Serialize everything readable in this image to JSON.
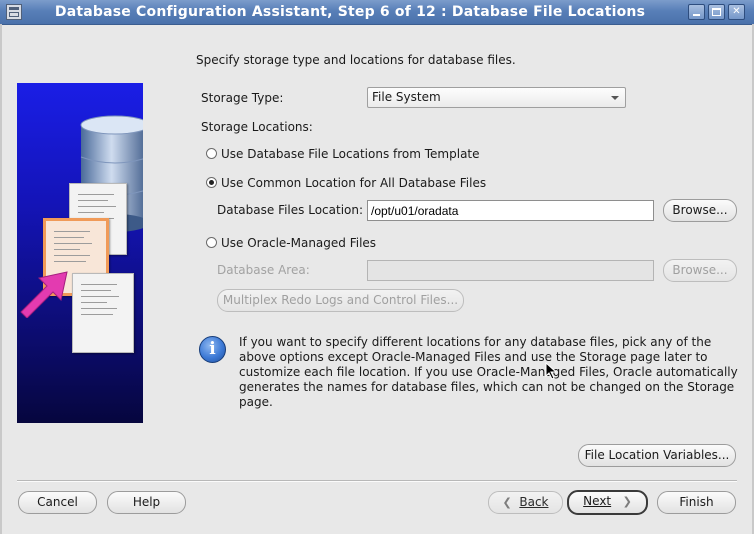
{
  "window": {
    "title": "Database Configuration Assistant, Step 6 of 12 : Database File Locations",
    "controls": [
      "minimize-icon",
      "maximize-icon",
      "close-icon"
    ]
  },
  "instruction": "Specify storage type and locations for database files.",
  "storage_type": {
    "label": "Storage Type:",
    "selected": "File System"
  },
  "storage_locations": {
    "label": "Storage Locations:",
    "options": [
      {
        "label": "Use Database File Locations from Template",
        "selected": false,
        "enabled": true
      },
      {
        "label": "Use Common Location for All Database Files",
        "selected": true,
        "enabled": true
      },
      {
        "label": "Use Oracle-Managed Files",
        "selected": false,
        "enabled": true
      }
    ],
    "files_location": {
      "label": "Database Files Location:",
      "value": "/opt/u01/oradata",
      "browse": "Browse..."
    },
    "db_area": {
      "label": "Database Area:",
      "value": "",
      "browse": "Browse..."
    },
    "multiplex_button": "Multiplex Redo Logs and Control Files..."
  },
  "info": {
    "icon": "info-icon",
    "text": "If you want to specify different locations for any database files, pick any of the above options except Oracle-Managed Files and use the Storage page later to customize each file location. If you use Oracle-Managed Files, Oracle automatically generates the names for database files, which can not be changed on the Storage page."
  },
  "file_location_variables": "File Location Variables...",
  "footer": {
    "cancel": "Cancel",
    "help": "Help",
    "back": "Back",
    "next": "Next",
    "finish": "Finish"
  },
  "colors": {
    "titlebar": "#587fb8",
    "side_panel": "#1414b8",
    "background": "#e8e8e8"
  }
}
